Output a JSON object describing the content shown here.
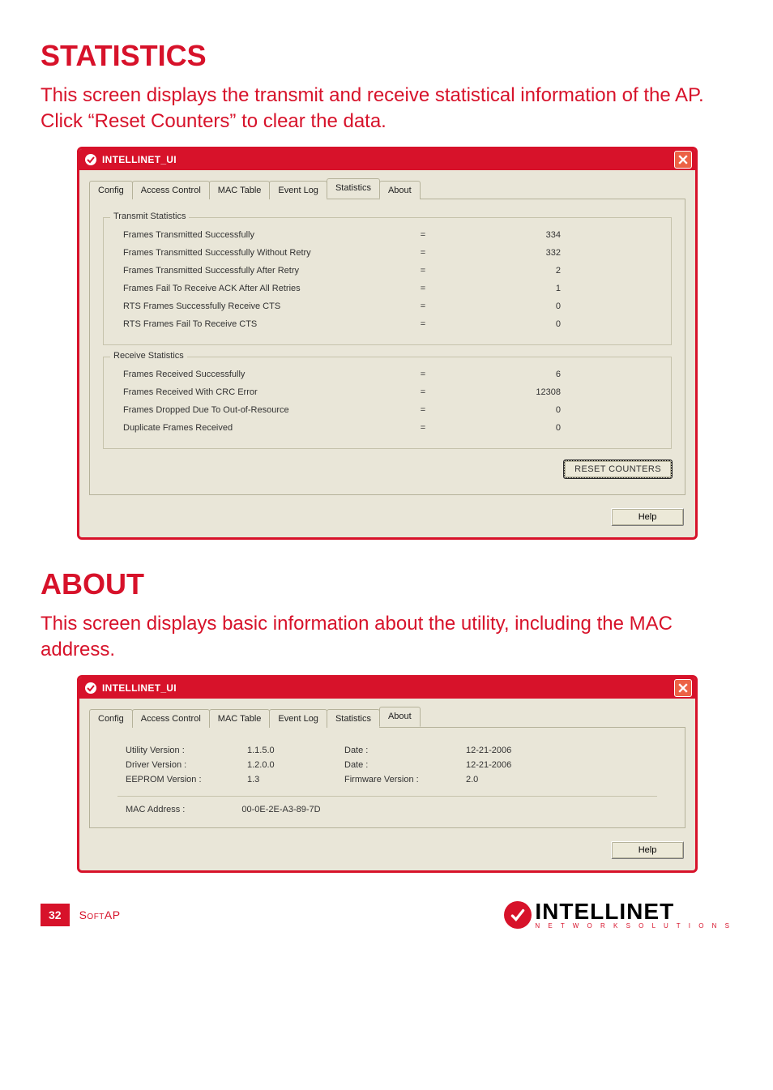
{
  "sections": {
    "statistics": {
      "heading": "STATISTICS",
      "body": "This screen displays the transmit and receive statistical information of the AP. Click “Reset Counters” to clear the data."
    },
    "about": {
      "heading": "ABOUT",
      "body": "This screen displays basic information about the utility, including the MAC address."
    }
  },
  "window_title": "INTELLINET_UI",
  "tabs": {
    "config": "Config",
    "access_control": "Access Control",
    "mac_table": "MAC Table",
    "event_log": "Event Log",
    "statistics": "Statistics",
    "about": "About"
  },
  "stats_panel": {
    "transmit_title": "Transmit Statistics",
    "receive_title": "Receive Statistics",
    "eq": "=",
    "transmit": [
      {
        "label": "Frames Transmitted Successfully",
        "value": "334"
      },
      {
        "label": "Frames Transmitted Successfully  Without Retry",
        "value": "332"
      },
      {
        "label": "Frames Transmitted Successfully After Retry",
        "value": "2"
      },
      {
        "label": "Frames Fail To Receive ACK After All Retries",
        "value": "1"
      },
      {
        "label": "RTS Frames Successfully Receive CTS",
        "value": "0"
      },
      {
        "label": "RTS Frames Fail To Receive CTS",
        "value": "0"
      }
    ],
    "receive": [
      {
        "label": "Frames Received Successfully",
        "value": "6"
      },
      {
        "label": "Frames Received With CRC Error",
        "value": "12308"
      },
      {
        "label": "Frames Dropped Due To Out-of-Resource",
        "value": "0"
      },
      {
        "label": "Duplicate Frames Received",
        "value": "0"
      }
    ],
    "reset_btn": "RESET COUNTERS",
    "help_btn": "Help"
  },
  "about_panel": {
    "utility_label": "Utility Version :",
    "utility_value": "1.1.5.0",
    "driver_label": "Driver Version :",
    "driver_value": "1.2.0.0",
    "eeprom_label": "EEPROM Version :",
    "eeprom_value": "1.3",
    "date_label": "Date :",
    "date1": "12-21-2006",
    "date2": "12-21-2006",
    "fw_label": "Firmware Version :",
    "fw_value": "2.0",
    "mac_label": "MAC Address :",
    "mac_value": "00-0E-2E-A3-89-7D",
    "help_btn": "Help"
  },
  "footer": {
    "page": "32",
    "section": "SoftAP",
    "brand_name": "INTELLINET",
    "brand_sub": "N E T W O R K   S O L U T I O N S"
  }
}
